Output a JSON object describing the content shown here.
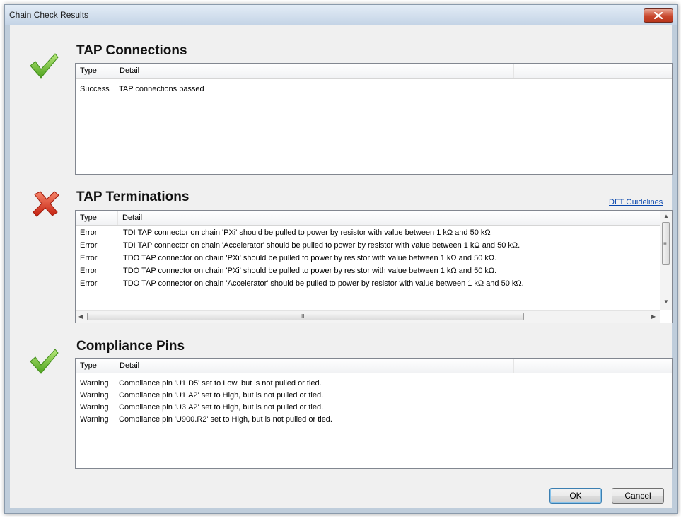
{
  "window": {
    "title": "Chain Check Results"
  },
  "sections": [
    {
      "title": "TAP Connections",
      "status": "pass",
      "icon": "checkmark-icon",
      "columns": [
        "Type",
        "Detail"
      ],
      "rows": [
        {
          "type": "Success",
          "detail": "TAP connections passed"
        }
      ]
    },
    {
      "title": "TAP Terminations",
      "status": "fail",
      "icon": "red-x-icon",
      "link": "DFT Guidelines",
      "columns": [
        "Type",
        "Detail"
      ],
      "rows": [
        {
          "type": "Error",
          "detail": "TDI TAP connector on chain 'PXi' should be pulled to power by resistor with value between 1 kΩ and 50 kΩ"
        },
        {
          "type": "Error",
          "detail": "TDI TAP connector on chain 'Accelerator' should be pulled to power by resistor with value between 1 kΩ and 50 kΩ."
        },
        {
          "type": "Error",
          "detail": "TDO TAP connector on chain 'PXi' should be pulled to power by resistor with value between 1 kΩ and 50 kΩ."
        },
        {
          "type": "Error",
          "detail": "TDO TAP connector on chain 'PXi' should be pulled to power by resistor with value between 1 kΩ and 50 kΩ."
        },
        {
          "type": "Error",
          "detail": "TDO TAP connector on chain 'Accelerator' should be pulled to power by resistor with value between 1 kΩ and 50 kΩ."
        }
      ]
    },
    {
      "title": "Compliance Pins",
      "status": "pass",
      "icon": "checkmark-icon",
      "columns": [
        "Type",
        "Detail"
      ],
      "rows": [
        {
          "type": "Warning",
          "detail": "Compliance pin 'U1.D5' set to Low, but is not pulled or tied."
        },
        {
          "type": "Warning",
          "detail": "Compliance pin 'U1.A2' set to High, but is not pulled or tied."
        },
        {
          "type": "Warning",
          "detail": "Compliance pin 'U3.A2' set to High, but is not pulled or tied."
        },
        {
          "type": "Warning",
          "detail": "Compliance pin 'U900.R2' set to High, but is not pulled or tied."
        }
      ]
    }
  ],
  "buttons": {
    "ok": "OK",
    "cancel": "Cancel"
  },
  "scrollbar": {
    "grip": "III",
    "grip_v": "≡"
  },
  "colors": {
    "pass": "#5fb82a",
    "fail": "#e0301e",
    "link": "#0645ad"
  }
}
